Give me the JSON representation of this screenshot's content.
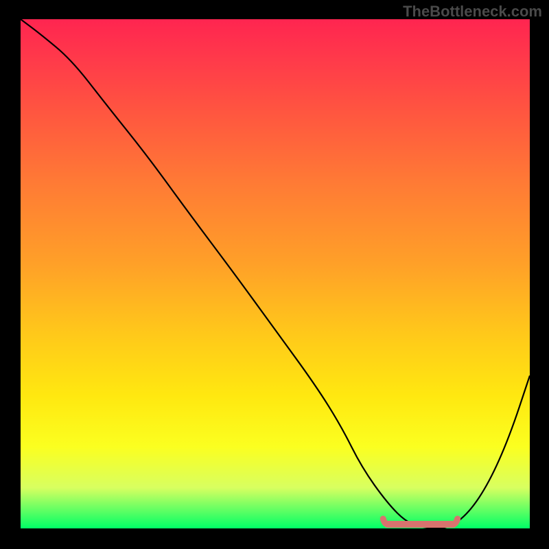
{
  "watermark": "TheBottleneck.com",
  "chart_data": {
    "type": "line",
    "title": "",
    "xlabel": "",
    "ylabel": "",
    "xlim": [
      0,
      100
    ],
    "ylim": [
      0,
      100
    ],
    "series": [
      {
        "name": "bottleneck-curve",
        "x": [
          0,
          4,
          10,
          17,
          25,
          33,
          42,
          50,
          58,
          63,
          67,
          72,
          76,
          80,
          84,
          88,
          92,
          96,
          100
        ],
        "values": [
          100,
          97,
          92,
          83,
          73,
          62,
          50,
          39,
          28,
          20,
          12,
          5,
          1,
          0,
          0,
          3,
          9,
          18,
          30
        ]
      }
    ],
    "markers": [
      {
        "name": "optimal-range-marker",
        "x_start": 72,
        "x_end": 85,
        "y": 0,
        "color": "#d9736e"
      }
    ],
    "gradient_meaning": "vertical color gradient from red (high bottleneck) at top to green (no bottleneck) at bottom"
  }
}
